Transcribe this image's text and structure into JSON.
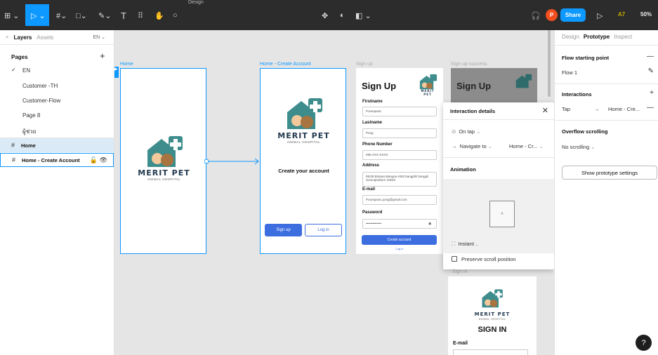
{
  "toolbar": {
    "title": "Design",
    "share_label": "Share",
    "avatar_letter": "P",
    "user_initials": "A7",
    "zoom": "50%"
  },
  "left_panel": {
    "tab_layers": "Layers",
    "tab_assets": "Assets",
    "language": "EN",
    "pages_heading": "Pages",
    "pages": [
      "EN",
      "Customer -TH",
      "Customer-Flow",
      "Page 8",
      "ผู้ช่วย"
    ],
    "layers": [
      "Home",
      "Home - Create Account"
    ]
  },
  "canvas": {
    "frames": {
      "home": "Home",
      "create_account": "Home - Create Account",
      "sign_up": "Sign up",
      "sign_up_success": "Sign up-success",
      "sign_in": "Sign in"
    },
    "logo_brand": "MERIT PET",
    "logo_sub": "ANIMAL HOSPITAL",
    "create_account_heading": "Create your account",
    "signup_button": "Sign up",
    "login_button": "Log in",
    "signup_form": {
      "title": "Sign Up",
      "fields": [
        {
          "label": "Firstname",
          "value": "Poompavic"
        },
        {
          "label": "Lastname",
          "value": "Pong"
        },
        {
          "label": "Phone Number",
          "value": "095-XXX-XXXX"
        },
        {
          "label": "Address",
          "value": "95/38 Britania Bangna KM3 bangphli bangpli Sumutprakarn 10540"
        },
        {
          "label": "E-mail",
          "value": "Poompavic.pong@gmail.com"
        },
        {
          "label": "Password",
          "value": "••••••••••••••"
        }
      ],
      "create_button": "Create account",
      "login_link": "Log in"
    },
    "success_title": "Sign Up",
    "signin_title": "SIGN IN",
    "signin_email_label": "E-mail"
  },
  "popup": {
    "title": "Interaction details",
    "trigger": "On tap",
    "action": "Navigate to",
    "destination": "Home - Cr...",
    "animation_heading": "Animation",
    "preview_letter": "A",
    "transition": "Instant",
    "preserve_scroll": "Preserve scroll position"
  },
  "right_panel": {
    "tab_design": "Design",
    "tab_prototype": "Prototype",
    "tab_inspect": "Inspect",
    "flow_heading": "Flow starting point",
    "flow_name": "Flow 1",
    "interactions_heading": "Interactions",
    "interaction_trigger": "Tap",
    "interaction_target": "Home - Cre...",
    "overflow_heading": "Overflow scrolling",
    "overflow_value": "No scrolling",
    "settings_button": "Show prototype settings"
  },
  "help_label": "?",
  "colors": {
    "accent": "#0d99ff",
    "toolbar_bg": "#2c2c2c",
    "button_blue": "#3d6ee0",
    "logo_teal": "#3e8c8c"
  }
}
